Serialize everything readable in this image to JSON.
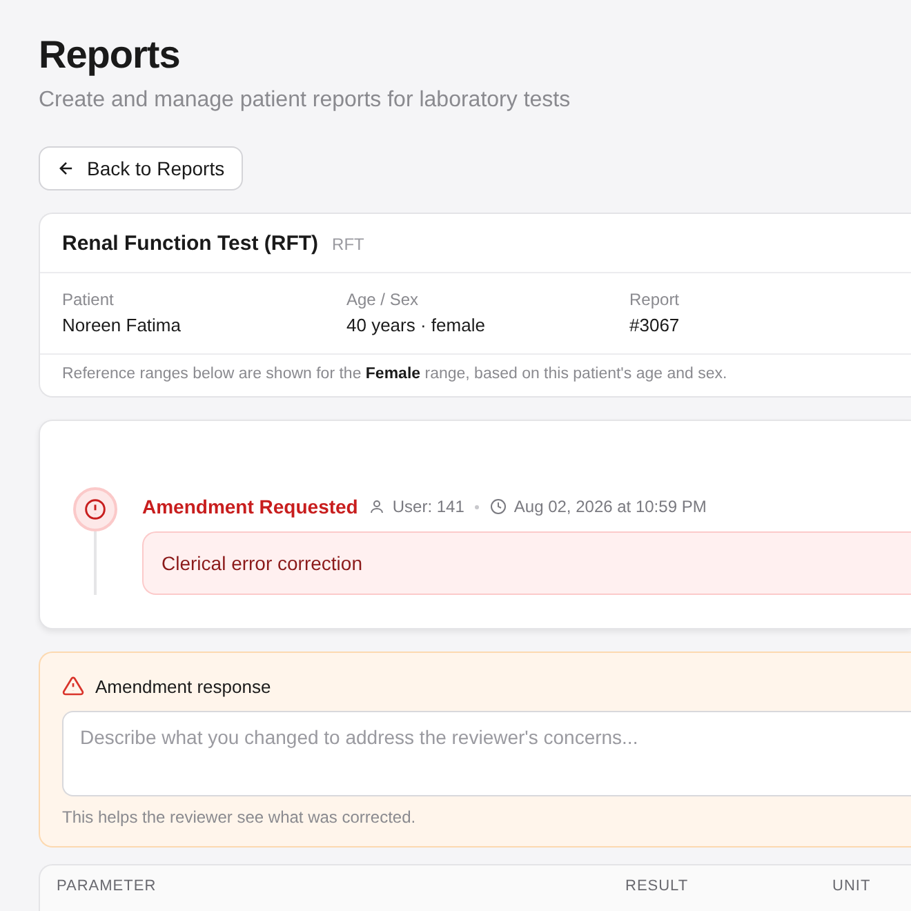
{
  "header": {
    "title": "Reports",
    "subtitle": "Create and manage patient reports for laboratory tests"
  },
  "back_button": {
    "label": "Back to Reports"
  },
  "test_card": {
    "title": "Renal Function Test (RFT)",
    "code": "RFT",
    "fields": [
      {
        "label": "Patient",
        "value": "Noreen Fatima"
      },
      {
        "label": "Age / Sex",
        "value": "40 years · female"
      },
      {
        "label": "Report",
        "value": "#3067"
      }
    ],
    "note": "Reference ranges below are shown for the **Female** range, based on this patient's age and sex."
  },
  "timeline": [
    {
      "kind": "amendment",
      "title": "Amendment Requested",
      "user": "User: 141",
      "time": "Aug 02, 2026 at 10:59 PM",
      "message": "Clerical error correction"
    }
  ],
  "response": {
    "title": "Amendment response",
    "placeholder": "Describe what you changed to address the reviewer's concerns...",
    "hint": "This helps the reviewer see what was corrected."
  },
  "table": {
    "columns": [
      "PARAMETER",
      "RESULT",
      "UNIT"
    ]
  }
}
